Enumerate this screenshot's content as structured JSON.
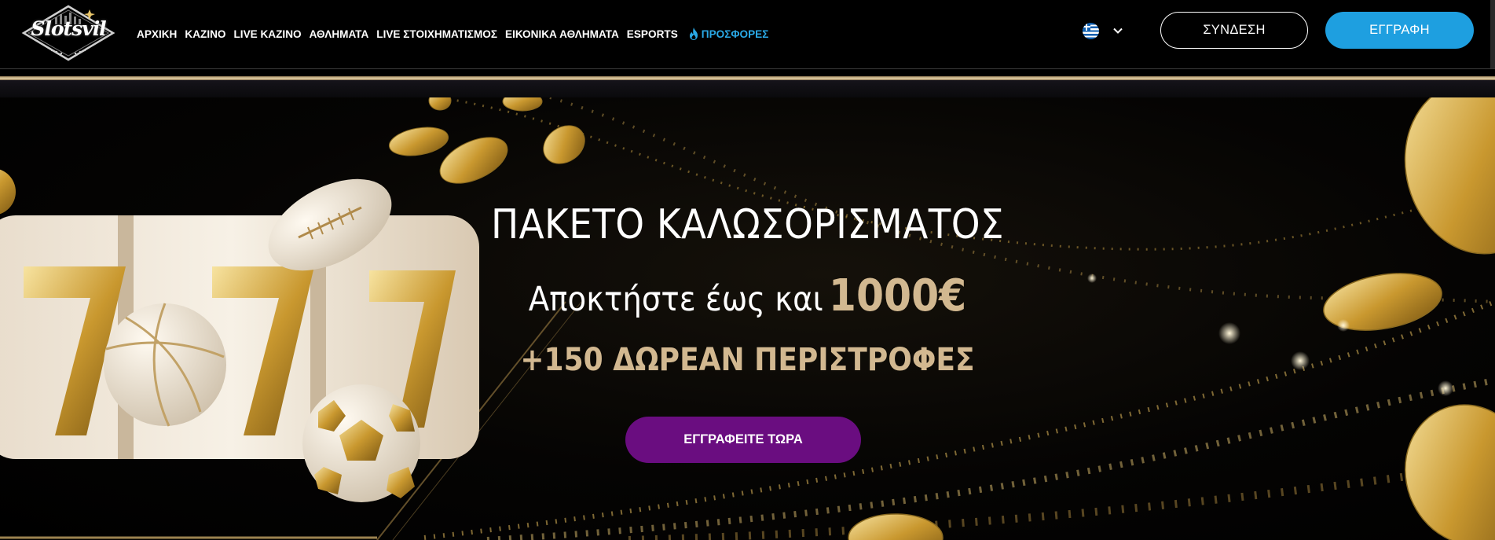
{
  "brand": {
    "logo_text": "Slotsvil"
  },
  "nav": {
    "items": [
      {
        "label": "ΑΡΧΙΚΗ"
      },
      {
        "label": "ΚΑΖΙΝΟ"
      },
      {
        "label": "LIVE ΚΑΖΙΝΟ"
      },
      {
        "label": "ΑΘΛΗΜΑΤΑ"
      },
      {
        "label": "LIVE ΣΤΟΙΧΗΜΑΤΙΣΜΟΣ"
      },
      {
        "label": "ΕΙΚΟΝΙΚΑ ΑΘΛΗΜΑΤΑ"
      },
      {
        "label": "ESPORTS"
      }
    ],
    "promo": {
      "label": "ΠΡΟΣΦΟΡΕΣ",
      "icon": "flame-icon",
      "color": "#2aa9e6"
    }
  },
  "language": {
    "flag": "greek-flag-icon",
    "dropdown_icon": "chevron-down-icon"
  },
  "auth": {
    "login_label": "ΣΥΝΔΕΣΗ",
    "register_label": "ΕΓΓΡΑΦΗ",
    "register_color": "#1e9fe0"
  },
  "hero": {
    "title": "ΠΑΚΕΤΟ ΚΑΛΩΣΟΡΙΣΜΑΤΟΣ",
    "subtitle_prefix": "Αποκτήστε έως και",
    "subtitle_amount": "1000€",
    "spins": "+150 ΔΩΡΕΑΝ ΠΕΡΙΣΤΡΟΦΕΣ",
    "cta_label": "ΕΓΓΡΑΦΕΙΤΕ ΤΩΡΑ",
    "cta_color": "#6a0d80",
    "accent_gold": "#d2b890"
  }
}
